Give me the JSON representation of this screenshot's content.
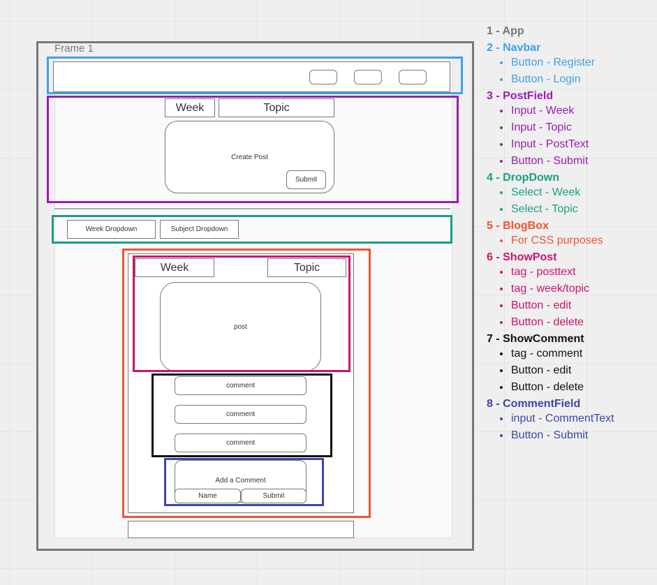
{
  "colors": {
    "app": "#777777",
    "navbar": "#3fa2e6",
    "postfield": "#9b1cb1",
    "dropdown": "#1a9e85",
    "blogbox": "#ee5434",
    "showpost": "#c8146e",
    "showcomment": "#111111",
    "commentfield": "#3e45a8"
  },
  "wireframe": {
    "frame_label": "Frame 1",
    "postfield": {
      "week_label": "Week",
      "topic_label": "Topic",
      "create_post_label": "Create Post",
      "submit_label": "Submit"
    },
    "dropdowns": {
      "week_label": "Week Dropdown",
      "subject_label": "Subject Dropdown"
    },
    "showpost": {
      "week_label": "Week",
      "topic_label": "Topic",
      "post_label": "post"
    },
    "comments": [
      "comment",
      "comment",
      "comment"
    ],
    "commentfield": {
      "add_label": "Add a Comment",
      "name_label": "Name",
      "submit_label": "Submit"
    }
  },
  "legend": [
    {
      "title": "1 - App",
      "color": "#777777",
      "items": []
    },
    {
      "title": "2 - Navbar",
      "color": "#3fa2e6",
      "items": [
        "Button - Register",
        "Button - Login"
      ]
    },
    {
      "title": "3 - PostField",
      "color": "#9b1cb1",
      "items": [
        "Input - Week",
        "Input - Topic",
        "Input - PostText",
        "Button - Submit"
      ]
    },
    {
      "title": "4 - DropDown",
      "color": "#1a9e85",
      "items": [
        "Select - Week",
        "Select - Topic"
      ]
    },
    {
      "title": "5 - BlogBox",
      "color": "#ee5434",
      "items": [
        "For CSS purposes"
      ]
    },
    {
      "title": "6 - ShowPost",
      "color": "#c8146e",
      "items": [
        "tag - posttext",
        "tag - week/topic",
        "Button - edit",
        "Button - delete"
      ]
    },
    {
      "title": "7 - ShowComment",
      "color": "#111111",
      "items": [
        "tag - comment",
        "Button - edit",
        "Button - delete"
      ]
    },
    {
      "title": "8 - CommentField",
      "color": "#3e45a8",
      "items": [
        "input - CommentText",
        "Button - Submit"
      ]
    }
  ]
}
